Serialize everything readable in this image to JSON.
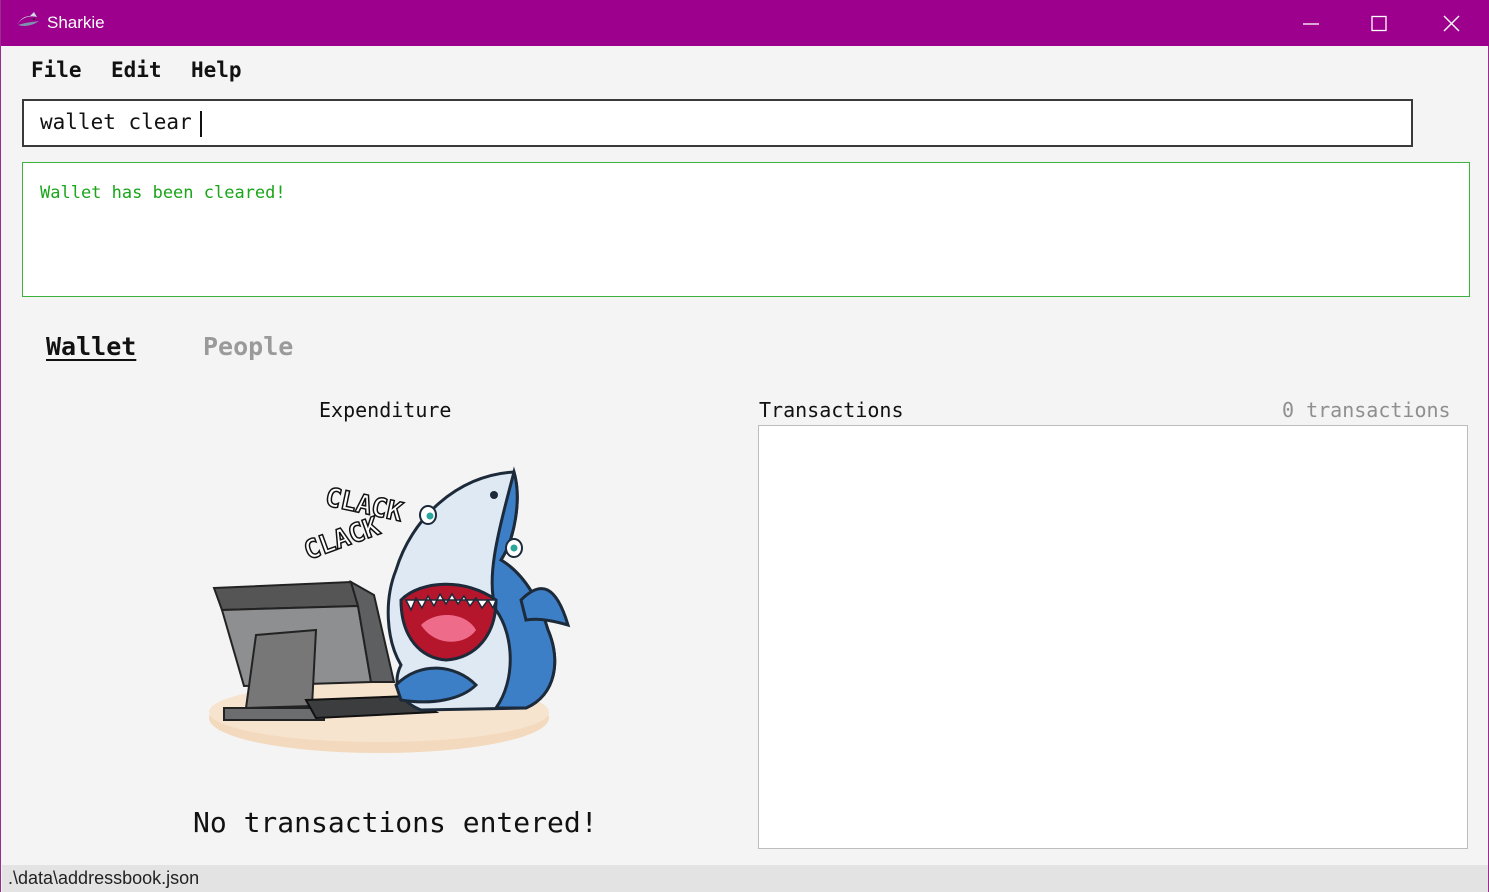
{
  "window": {
    "title": "Sharkie",
    "accent_color": "#9c008c"
  },
  "menu": {
    "file": "File",
    "edit": "Edit",
    "help": "Help"
  },
  "command": {
    "value": "wallet clear"
  },
  "result": {
    "message": "Wallet has been cleared!",
    "color": "#1aa51a"
  },
  "tabs": [
    {
      "label": "Wallet",
      "selected": true
    },
    {
      "label": "People",
      "selected": false
    }
  ],
  "expenditure": {
    "title": "Expenditure",
    "illustration": "shark-typing-clack-clack",
    "illustration_text": [
      "CLACK",
      "CLACK"
    ],
    "empty_message": "No transactions entered!"
  },
  "transactions": {
    "title": "Transactions",
    "count_label": "0 transactions",
    "items": []
  },
  "status": {
    "path": ".\\data\\addressbook.json"
  }
}
